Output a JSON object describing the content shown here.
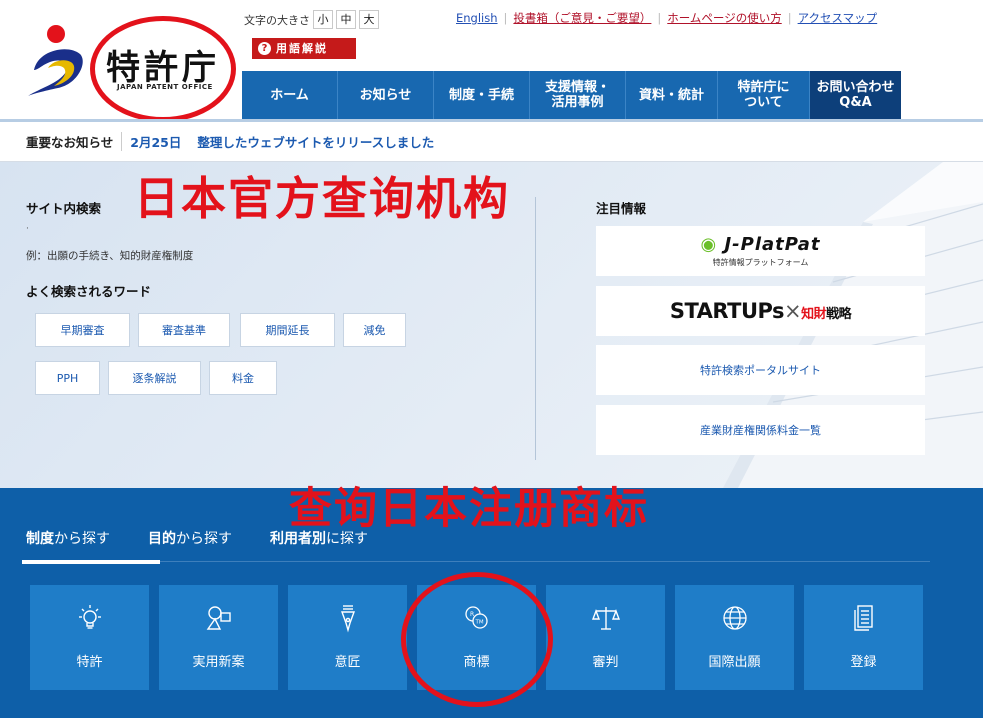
{
  "header": {
    "logo_title": "特許庁",
    "logo_sub": "JAPAN PATENT OFFICE",
    "fontsize_label": "文字の大きさ",
    "fontsize_options": [
      "小",
      "中",
      "大"
    ],
    "glossary": "用語解説",
    "util_links": [
      "English",
      "投書箱（ご意見・ご要望）",
      "ホームページの使い方",
      "アクセスマップ"
    ],
    "nav": [
      "ホーム",
      "お知らせ",
      "制度・手続",
      "支援情報・\n活用事例",
      "資料・統計",
      "特許庁に\nついて",
      "お問い合わせ\nQ&A"
    ]
  },
  "notice": {
    "label": "重要なお知らせ",
    "date": "2月25日",
    "text": "整理したウェブサイトをリリースしました"
  },
  "search": {
    "title": "サイト内検索",
    "dot": "·",
    "example": "例：出願の手続き、知的財産権制度",
    "popular_title": "よく検索されるワード",
    "keywords": [
      "早期審査",
      "審査基準",
      "期間延長",
      "減免",
      "PPH",
      "逐条解説",
      "料金"
    ]
  },
  "featured": {
    "title": "注目情報",
    "jpp_name": "J-PlatPat",
    "jpp_sub": "特許情報プラットフォーム",
    "startups": "STARTUPs",
    "startups_x": "×",
    "startups_chizai": "知財",
    "startups_senryaku": "戦略",
    "portal": "特許検索ポータルサイト",
    "fees": "産業財産権関係料金一覧"
  },
  "annotations": {
    "top": "日本官方查询机构",
    "bottom": "查询日本注册商标"
  },
  "browse": {
    "tabs": [
      {
        "bold": "制度",
        "rest": "から探す"
      },
      {
        "bold": "目的",
        "rest": "から探す"
      },
      {
        "bold": "利用者別",
        "rest": "に探す"
      }
    ],
    "tiles": [
      {
        "label": "特許",
        "icon": "lightbulb-icon"
      },
      {
        "label": "実用新案",
        "icon": "tools-icon"
      },
      {
        "label": "意匠",
        "icon": "pen-nib-icon"
      },
      {
        "label": "商標",
        "icon": "trademark-icon"
      },
      {
        "label": "審判",
        "icon": "scales-icon"
      },
      {
        "label": "国際出願",
        "icon": "globe-icon"
      },
      {
        "label": "登録",
        "icon": "document-icon"
      }
    ]
  },
  "colors": {
    "nav_blue": "#1868b0",
    "nav_dark": "#0d3f7a",
    "section_blue": "#0e5fa8",
    "tile_blue": "#1f7dc8",
    "annotation_red": "#e3121b",
    "glossary_red": "#c51a1a"
  }
}
